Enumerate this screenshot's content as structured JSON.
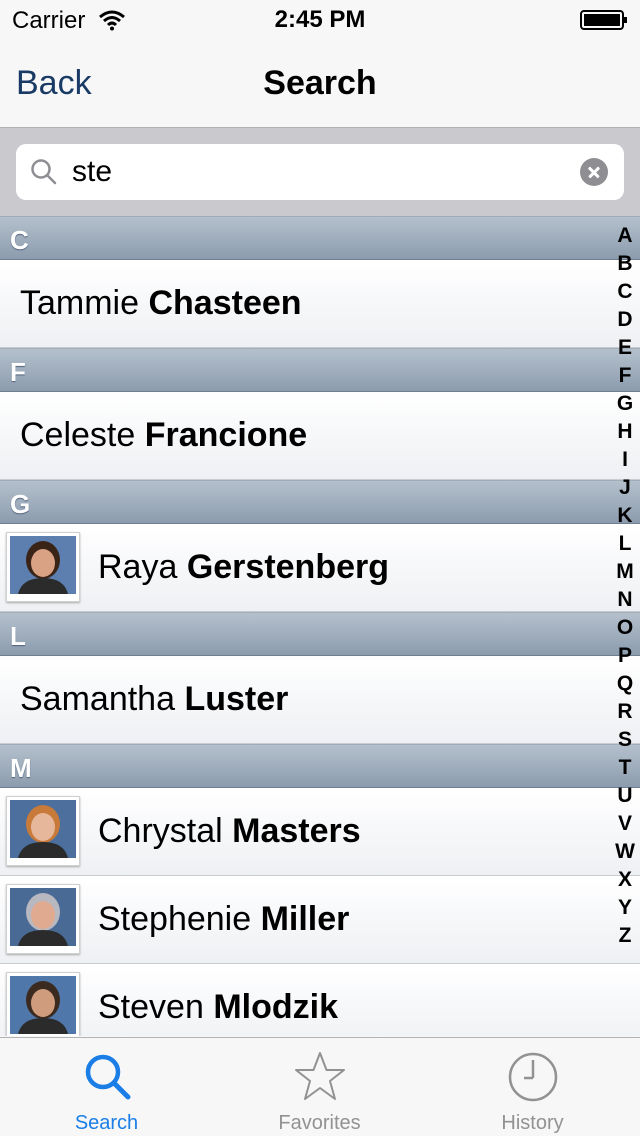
{
  "status_bar": {
    "carrier": "Carrier",
    "time": "2:45 PM"
  },
  "nav": {
    "back_label": "Back",
    "title": "Search"
  },
  "search": {
    "value": "ste",
    "placeholder": ""
  },
  "sections": [
    {
      "letter": "C",
      "people": [
        {
          "first": "Tammie",
          "last": "Chasteen",
          "photo": false
        }
      ]
    },
    {
      "letter": "F",
      "people": [
        {
          "first": "Celeste",
          "last": "Francione",
          "photo": false
        }
      ]
    },
    {
      "letter": "G",
      "people": [
        {
          "first": "Raya",
          "last": "Gerstenberg",
          "photo": true,
          "hair": "#3a2418",
          "skin": "#d9a285",
          "bg": "#5d7fb0"
        }
      ]
    },
    {
      "letter": "L",
      "people": [
        {
          "first": "Samantha",
          "last": "Luster",
          "photo": false
        }
      ]
    },
    {
      "letter": "M",
      "people": [
        {
          "first": "Chrystal",
          "last": "Masters",
          "photo": true,
          "hair": "#c77a3a",
          "skin": "#e6b79a",
          "bg": "#4c6f9e"
        },
        {
          "first": "Stephenie",
          "last": "Miller",
          "photo": true,
          "hair": "#b8b8c0",
          "skin": "#e0aa90",
          "bg": "#4a6a96"
        },
        {
          "first": "Steven",
          "last": "Mlodzik",
          "photo": true,
          "hair": "#3b2a20",
          "skin": "#cf9d7e",
          "bg": "#4f77aa"
        }
      ]
    }
  ],
  "index_letters": [
    "A",
    "B",
    "C",
    "D",
    "E",
    "F",
    "G",
    "H",
    "I",
    "J",
    "K",
    "L",
    "M",
    "N",
    "O",
    "P",
    "Q",
    "R",
    "S",
    "T",
    "U",
    "V",
    "W",
    "X",
    "Y",
    "Z"
  ],
  "tabs": [
    {
      "label": "Search",
      "icon": "search-icon",
      "active": true
    },
    {
      "label": "Favorites",
      "icon": "star-icon",
      "active": false
    },
    {
      "label": "History",
      "icon": "clock-icon",
      "active": false
    }
  ],
  "colors": {
    "tab_active": "#1a7ee6",
    "tab_inactive": "#929292",
    "nav_tint": "#1a3a66"
  }
}
